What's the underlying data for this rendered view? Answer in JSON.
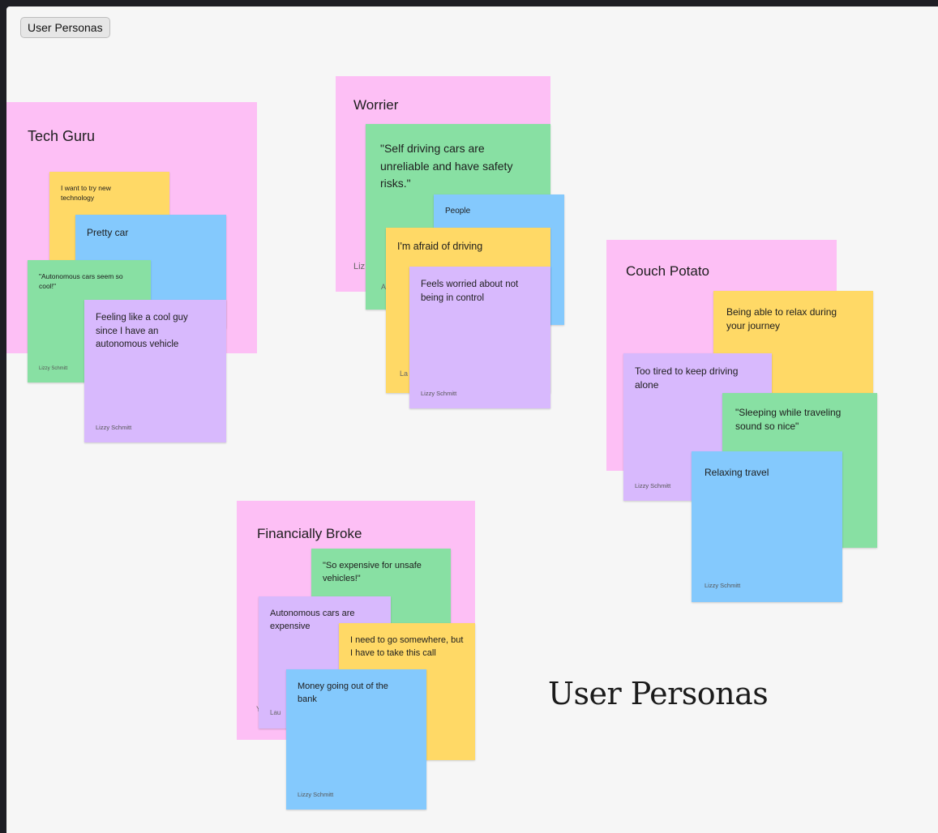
{
  "frame_label": "User Personas",
  "board_title": "User Personas",
  "personas": {
    "tech_guru": {
      "title": "Tech Guru",
      "notes": [
        {
          "text": "I want to try new technology",
          "author": ""
        },
        {
          "text": "Pretty car",
          "author": ""
        },
        {
          "text": "\"Autonomous cars seem so cool!\"",
          "author": "Lizzy Schmitt"
        },
        {
          "text": "Feeling like a cool guy since I have an autonomous vehicle",
          "author": "Lizzy Schmitt"
        }
      ]
    },
    "worrier": {
      "title": "Worrier",
      "partial_author": "Liz",
      "partial_a": "A",
      "partial_la": "La",
      "notes": [
        {
          "text": "\"Self driving cars are unreliable and have safety risks.\"",
          "author": ""
        },
        {
          "text": "People",
          "author": ""
        },
        {
          "text": "I'm afraid of driving",
          "author": ""
        },
        {
          "text": "Feels worried about not being in control",
          "author": "Lizzy Schmitt"
        }
      ]
    },
    "couch_potato": {
      "title": "Couch Potato",
      "notes": [
        {
          "text": "Being able to relax during your journey",
          "author": ""
        },
        {
          "text": "Too tired to keep driving alone",
          "author": "Lizzy Schmitt"
        },
        {
          "text": "\"Sleeping while traveling sound so nice\"",
          "author": ""
        },
        {
          "text": "Relaxing travel",
          "author": "Lizzy Schmitt"
        }
      ]
    },
    "financially_broke": {
      "title": "Financially Broke",
      "partial_y": "Y",
      "partial_la": "Lau",
      "notes": [
        {
          "text": "\"So expensive for unsafe vehicles!\"",
          "author": ""
        },
        {
          "text": "Autonomous cars are expensive",
          "author": ""
        },
        {
          "text": "I need to go somewhere, but I have to take this call",
          "author": ""
        },
        {
          "text": "Money going out of the bank",
          "author": "Lizzy Schmitt"
        }
      ]
    }
  },
  "colors": {
    "persona_bg": "#fdbff5",
    "yellow": "#ffd966",
    "blue": "#84c9fd",
    "green": "#88e0a3",
    "purple": "#d8b9fd"
  }
}
